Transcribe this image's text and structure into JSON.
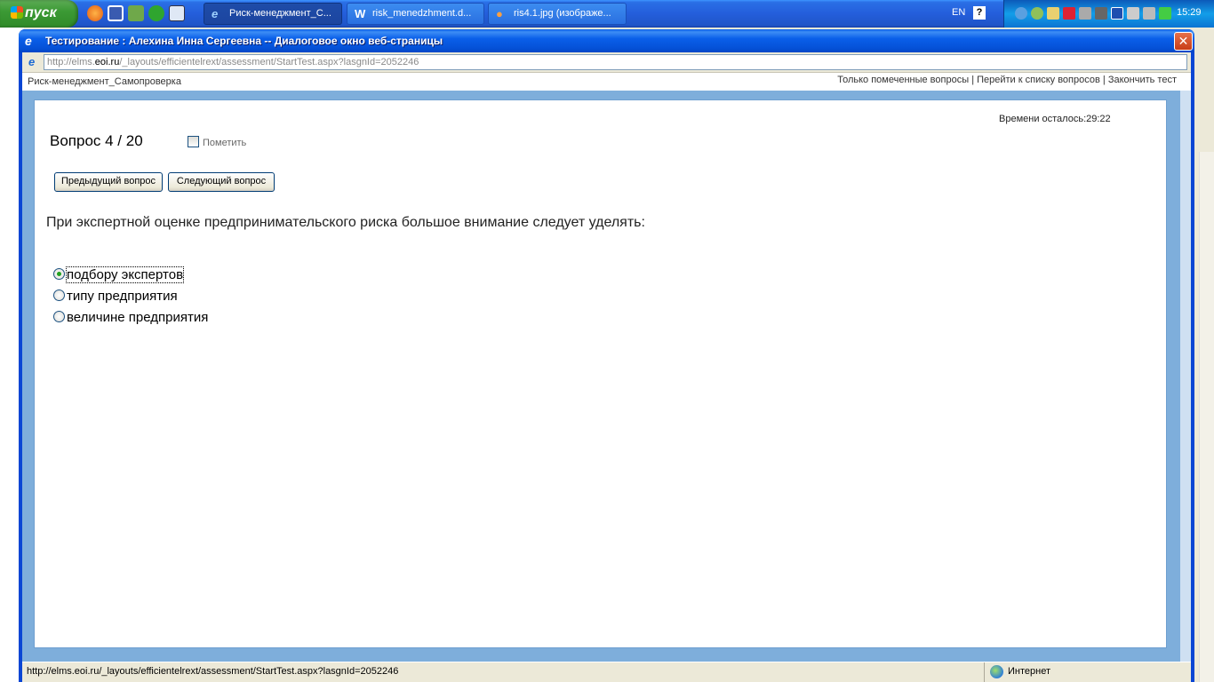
{
  "taskbar": {
    "start_label": "пуск",
    "tasks": [
      {
        "label": "Риск-менеджмент_С...",
        "icon": "ie-icon"
      },
      {
        "label": "risk_menedzhment.d...",
        "icon": "word-doc-icon"
      },
      {
        "label": "ris4.1.jpg (изображе...",
        "icon": "firefox-icon"
      }
    ],
    "language": "EN",
    "clock": "15:29"
  },
  "dialog": {
    "title": "Тестирование : Алехина Инна Сергеевна -- Диалоговое окно веб-страницы",
    "address_prefix": "http://elms.",
    "address_domain": "eoi.ru",
    "address_suffix": "/_layouts/efficientelrext/assessment/StartTest.aspx?lasgnId=2052246"
  },
  "page": {
    "course_title": "Риск-менеджмент_Самопроверка",
    "links": {
      "marked_only": "Только помеченные вопросы",
      "separator": "|",
      "go_to_list": "Перейти к списку вопросов",
      "finish_test": "Закончить тест"
    },
    "timer_label": "Времени осталось:",
    "timer_value": "29:22",
    "question_number": "Вопрос 4 / 20",
    "mark_label": "Пометить",
    "prev_button": "Предыдущий вопрос",
    "next_button": "Следующий вопрос",
    "question_text": "При экспертной оценке предпринимательского риска большое внимание следует уделять:",
    "options": [
      {
        "label": "подбору экспертов",
        "selected": true
      },
      {
        "label": "типу предприятия",
        "selected": false
      },
      {
        "label": "величине предприятия",
        "selected": false
      }
    ]
  },
  "statusbar": {
    "url": "http://elms.eoi.ru/_layouts/efficientelrext/assessment/StartTest.aspx?lasgnId=2052246",
    "zone": "Интернет"
  }
}
